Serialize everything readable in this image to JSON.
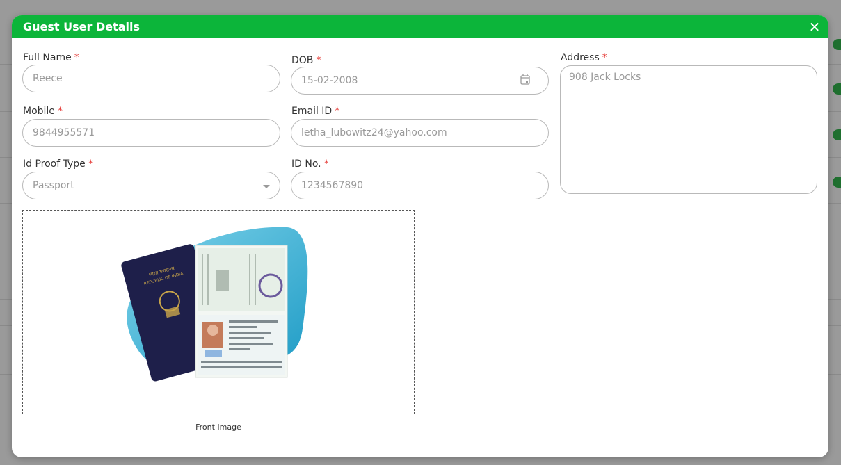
{
  "modal": {
    "title": "Guest User Details",
    "close_symbol": "✕"
  },
  "form": {
    "full_name": {
      "label": "Full Name",
      "required": "*",
      "value": "Reece"
    },
    "dob": {
      "label": "DOB",
      "required": "*",
      "value": "15-02-2008",
      "icon": "calendar-icon"
    },
    "address": {
      "label": "Address",
      "required": "*",
      "value": "908 Jack Locks"
    },
    "mobile": {
      "label": "Mobile",
      "required": "*",
      "value": "9844955571"
    },
    "email": {
      "label": "Email ID",
      "required": "*",
      "value": "letha_lubowitz24@yahoo.com"
    },
    "id_proof_type": {
      "label": "Id Proof Type",
      "required": "*",
      "value": "Passport",
      "icon": "chevron-down-icon"
    },
    "id_no": {
      "label": "ID No.",
      "required": "*",
      "value": "1234567890"
    }
  },
  "image": {
    "caption": "Front Image",
    "passport_text": [
      "भारत गणराज्य",
      "REPUBLIC OF INDIA"
    ]
  },
  "colors": {
    "header": "#0cb53a",
    "required": "#e53935"
  }
}
